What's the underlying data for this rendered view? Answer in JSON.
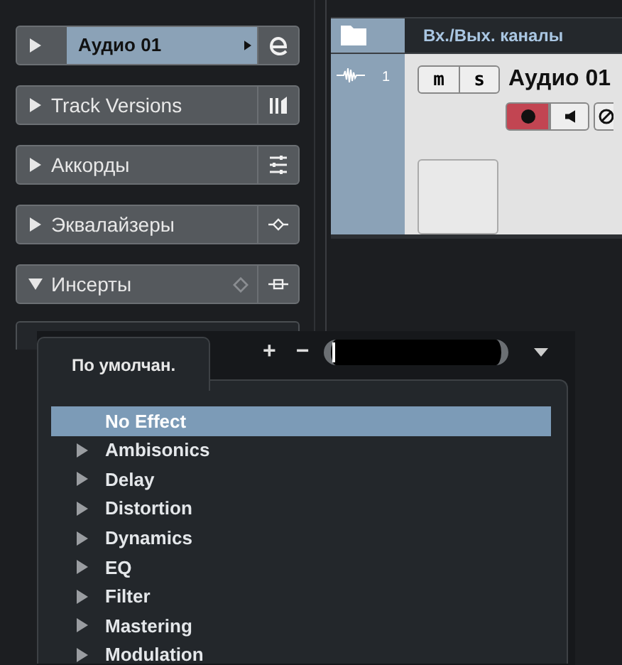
{
  "inspector_sections": [
    {
      "label": "Аудио 01",
      "kind": "track",
      "selected": true,
      "expanded": false
    },
    {
      "label": "Track Versions",
      "kind": "versions",
      "selected": false,
      "expanded": false
    },
    {
      "label": "Аккорды",
      "kind": "chords",
      "selected": false,
      "expanded": false
    },
    {
      "label": "Эквалайзеры",
      "kind": "eq",
      "selected": false,
      "expanded": false
    },
    {
      "label": "Инсерты",
      "kind": "inserts",
      "selected": false,
      "expanded": true
    }
  ],
  "track_list": {
    "header": "Вх./Вых. каналы",
    "track": {
      "number": "1",
      "mute": "m",
      "solo": "s",
      "name": "Аудио 01",
      "record_enabled": true
    }
  },
  "plugin_popup": {
    "tab": "По умолчан.",
    "add": "+",
    "remove": "−",
    "search": {
      "kind": "field"
    },
    "items": [
      {
        "label": "No Effect",
        "kind": "effect",
        "selected": true
      },
      {
        "label": "Ambisonics",
        "kind": "folder",
        "selected": false,
        "expanded": false
      },
      {
        "label": "Delay",
        "kind": "folder",
        "selected": false,
        "expanded": false
      },
      {
        "label": "Distortion",
        "kind": "folder",
        "selected": false,
        "expanded": false
      },
      {
        "label": "Dynamics",
        "kind": "folder",
        "selected": false,
        "expanded": false
      },
      {
        "label": "EQ",
        "kind": "folder",
        "selected": false,
        "expanded": false
      },
      {
        "label": "Filter",
        "kind": "folder",
        "selected": false,
        "expanded": false
      },
      {
        "label": "Mastering",
        "kind": "folder",
        "selected": false,
        "expanded": false
      },
      {
        "label": "Modulation",
        "kind": "folder",
        "selected": false,
        "expanded": false
      }
    ]
  }
}
